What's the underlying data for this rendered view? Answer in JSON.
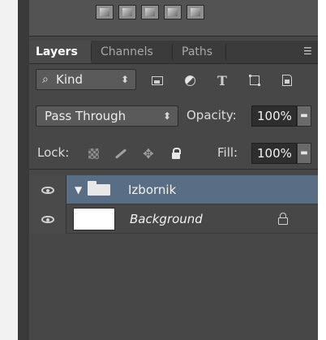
{
  "tabs": [
    {
      "label": "Layers",
      "active": true
    },
    {
      "label": "Channels",
      "active": false
    },
    {
      "label": "Paths",
      "active": false
    }
  ],
  "filter": {
    "kind_label": "Kind",
    "icons": [
      "image-filter-icon",
      "adjustment-filter-icon",
      "type-filter-icon",
      "shape-filter-icon",
      "smart-object-filter-icon"
    ],
    "type_glyph": "T"
  },
  "blend": {
    "mode": "Pass Through",
    "opacity_label": "Opacity:",
    "opacity_value": "100%"
  },
  "lock": {
    "label": "Lock:",
    "icons": [
      "lock-transparent-pixels-icon",
      "lock-image-pixels-icon",
      "lock-position-icon",
      "lock-all-icon"
    ],
    "fill_label": "Fill:",
    "fill_value": "100%"
  },
  "layers": [
    {
      "name": "Izbornik",
      "type": "group",
      "selected": true
    },
    {
      "name": "Background",
      "type": "background",
      "selected": false,
      "locked": true
    }
  ],
  "colors": {
    "panel_bg": "#474747",
    "selected_row": "#596d84",
    "active_tab_text": "#ffffff"
  }
}
